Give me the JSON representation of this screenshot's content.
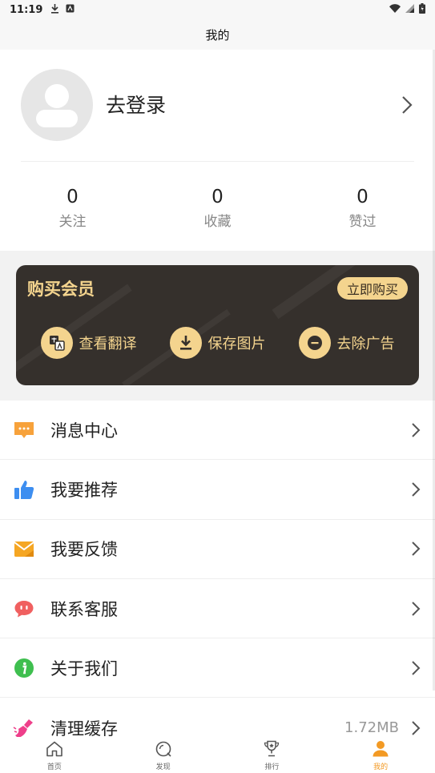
{
  "status_bar": {
    "time": "11:19"
  },
  "title": "我的",
  "profile": {
    "login_label": "去登录",
    "stats": [
      {
        "value": "0",
        "label": "关注"
      },
      {
        "value": "0",
        "label": "收藏"
      },
      {
        "value": "0",
        "label": "赞过"
      }
    ]
  },
  "vip": {
    "title": "购买会员",
    "buy_label": "立即购买",
    "features": [
      {
        "label": "查看翻译",
        "icon": "translate-icon"
      },
      {
        "label": "保存图片",
        "icon": "download-icon"
      },
      {
        "label": "去除广告",
        "icon": "remove-icon"
      }
    ],
    "colors": {
      "card": "#35302c",
      "gold": "#f4d48e"
    }
  },
  "menu": [
    {
      "label": "消息中心",
      "icon": "message-icon",
      "color": "#f7a23b"
    },
    {
      "label": "我要推荐",
      "icon": "thumbs-up-icon",
      "color": "#3d8ef0"
    },
    {
      "label": "我要反馈",
      "icon": "mail-icon",
      "color": "#f5a623"
    },
    {
      "label": "联系客服",
      "icon": "chat-icon",
      "color": "#f06060"
    },
    {
      "label": "关于我们",
      "icon": "info-icon",
      "color": "#3fbf4f"
    },
    {
      "label": "清理缓存",
      "icon": "broom-icon",
      "color": "#ee3f8a",
      "value": "1.72MB"
    }
  ],
  "tabs": [
    {
      "label": "首页",
      "icon": "home-icon"
    },
    {
      "label": "发现",
      "icon": "discover-icon"
    },
    {
      "label": "排行",
      "icon": "trophy-icon"
    },
    {
      "label": "我的",
      "icon": "user-icon",
      "active": true
    }
  ],
  "accent": "#f39a24"
}
